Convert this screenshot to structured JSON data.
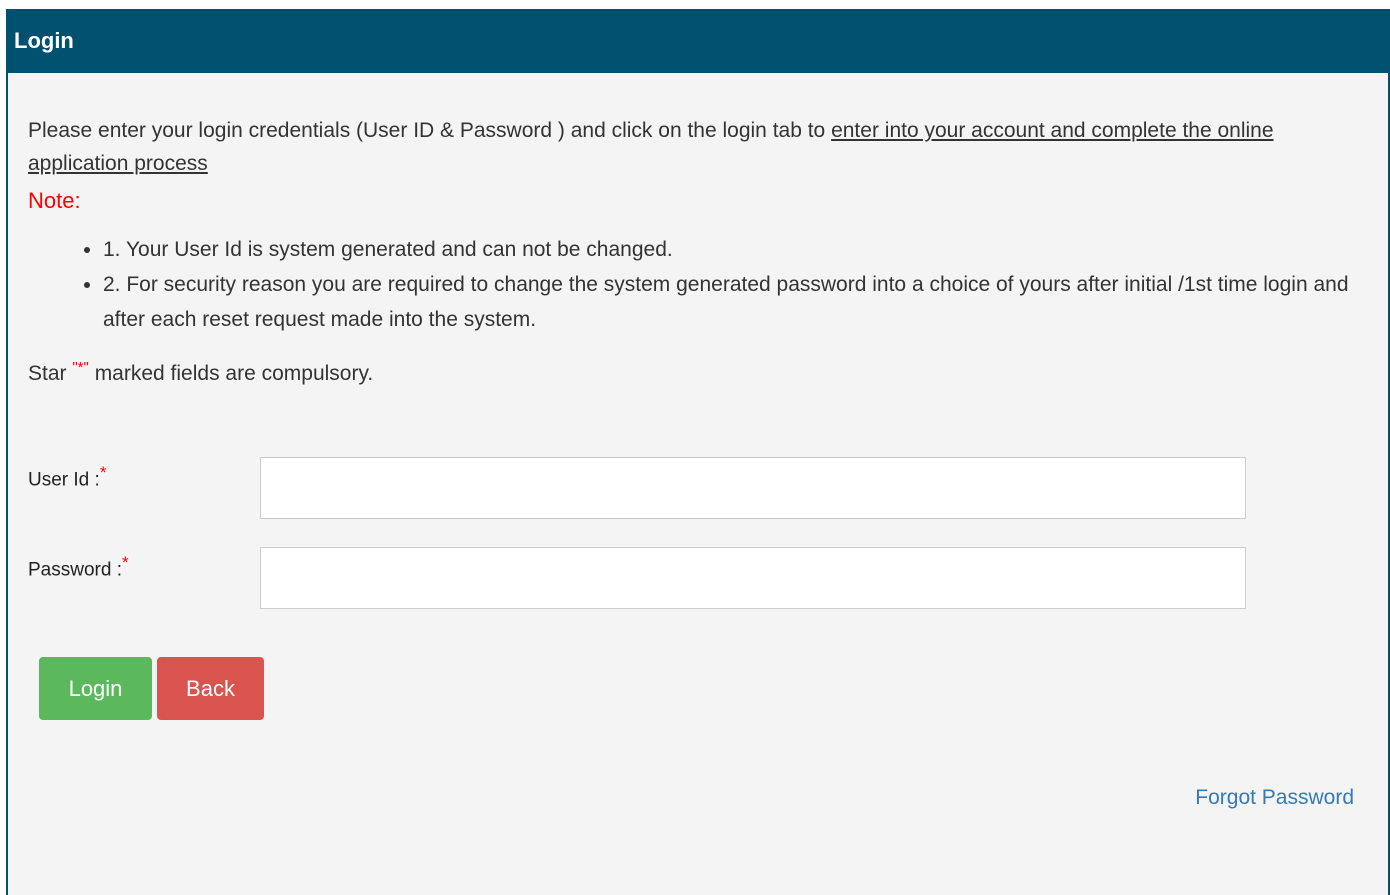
{
  "panel": {
    "title": "Login"
  },
  "intro": {
    "text": "Please enter your login credentials (User ID & Password ) and click on the login tab to ",
    "link_text": "enter into your account and complete the online application process"
  },
  "note": {
    "title": "Note",
    "colon": ":",
    "items": [
      "1. Your User Id is system generated and can not be changed.",
      "2. For security reason you are required to change the system generated password into a choice of yours after initial /1st time login and after each reset request made into the system."
    ]
  },
  "compulsory": {
    "prefix": "Star ",
    "star": "\"*\"",
    "suffix": " marked fields are compulsory."
  },
  "form": {
    "user_id_label": "User Id :",
    "password_label": "Password :",
    "required_mark": "*",
    "user_id_value": "",
    "password_value": ""
  },
  "buttons": {
    "login_label": "Login",
    "back_label": "Back"
  },
  "links": {
    "forgot_password": "Forgot Password"
  },
  "colors": {
    "header": "#005070",
    "login_button": "#5cb85c",
    "back_button": "#d9534f",
    "link": "#337ab7",
    "note": "#ff0000"
  }
}
